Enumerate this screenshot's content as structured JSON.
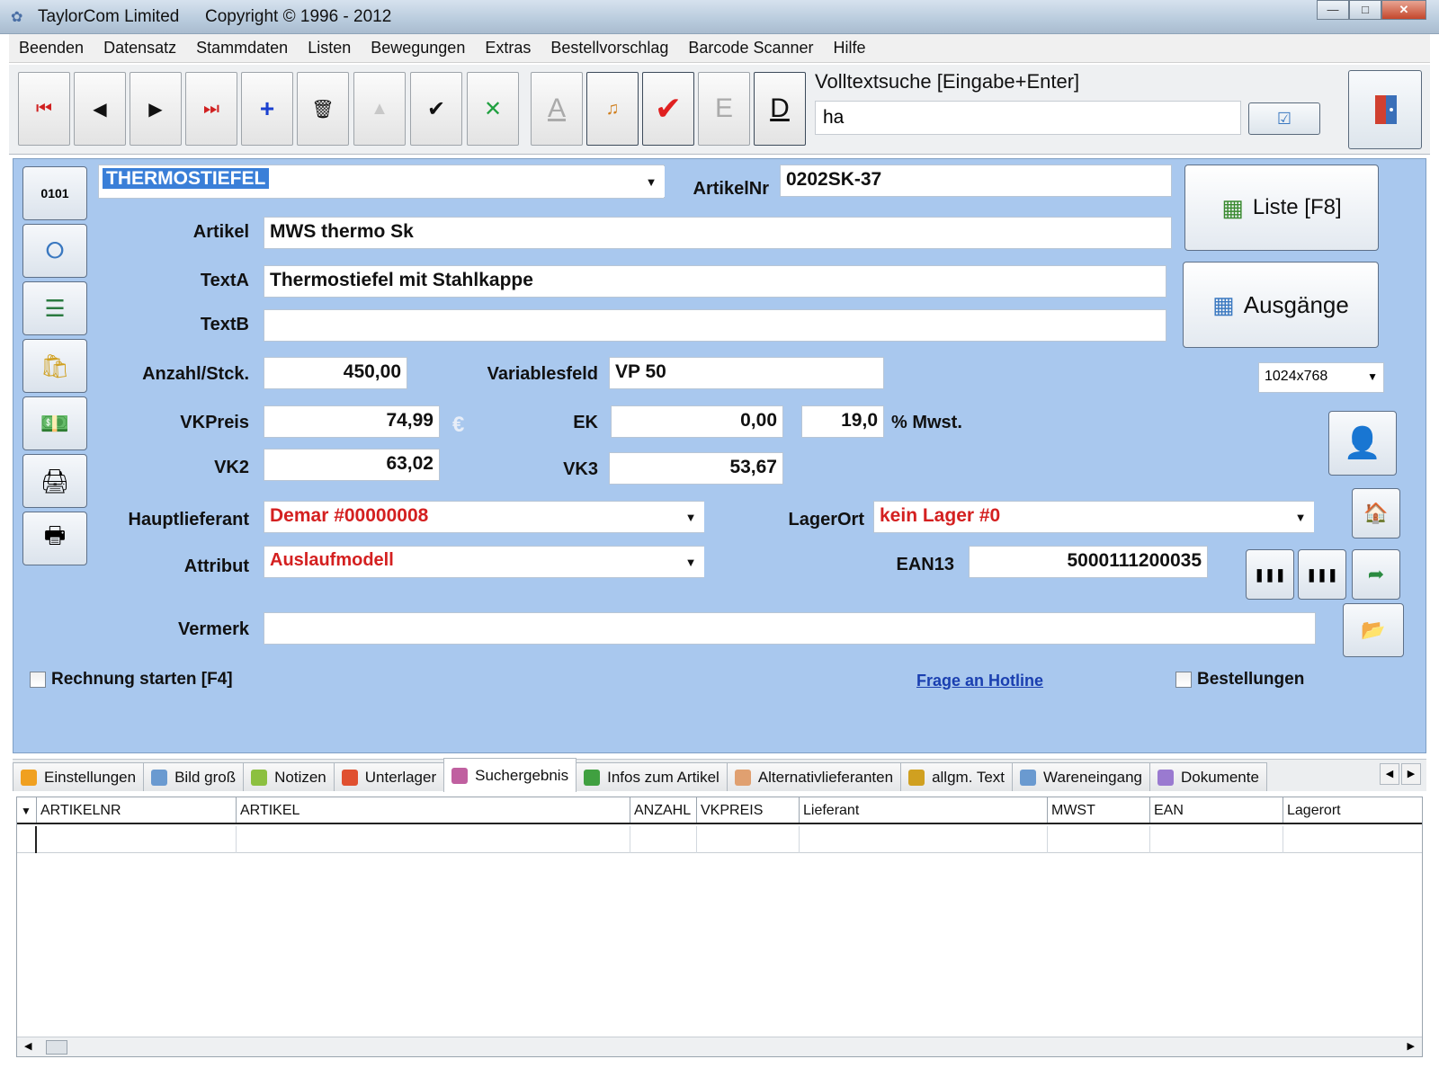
{
  "window": {
    "title": "TaylorCom Limited",
    "copyright": "Copyright © 1996 - 2012"
  },
  "menu": [
    "Beenden",
    "Datensatz",
    "Stammdaten",
    "Listen",
    "Bewegungen",
    "Extras",
    "Bestellvorschlag",
    "Barcode Scanner",
    "Hilfe"
  ],
  "toolbar": {
    "letter_a": "A",
    "letter_e": "E",
    "letter_d": "D",
    "search_label": "Volltextsuche [Eingabe+Enter]",
    "search_value": "ha"
  },
  "form": {
    "category": "THERMOSTIEFEL",
    "artikelnr_label": "ArtikelNr",
    "artikelnr": "0202SK-37",
    "artikel_label": "Artikel",
    "artikel": "MWS thermo Sk",
    "texta_label": "TextA",
    "texta": "Thermostiefel mit Stahlkappe",
    "textb_label": "TextB",
    "textb": "",
    "anzahl_label": "Anzahl/Stck.",
    "anzahl": "450,00",
    "variablesfeld_label": "Variablesfeld",
    "variablesfeld": "VP 50",
    "vkpreis_label": "VKPreis",
    "vkpreis": "74,99",
    "currency": "€",
    "ek_label": "EK",
    "ek": "0,00",
    "mwst": "19,0",
    "mwst_label": "% Mwst.",
    "vk2_label": "VK2",
    "vk2": "63,02",
    "vk3_label": "VK3",
    "vk3": "53,67",
    "hauptlieferant_label": "Hauptlieferant",
    "hauptlieferant": "Demar  #00000008",
    "lagerort_label": "LagerOrt",
    "lagerort": "kein Lager    #0",
    "attribut_label": "Attribut",
    "attribut": "Auslaufmodell",
    "ean13_label": "EAN13",
    "ean13": "5000111200035",
    "vermerk_label": "Vermerk",
    "vermerk": "",
    "liste_button": "Liste [F8]",
    "ausgaenge_button": "Ausgänge",
    "resolution": "1024x768",
    "rechnung_label": "Rechnung starten [F4]",
    "hotline_link": "Frage an Hotline",
    "bestellungen_label": "Bestellungen"
  },
  "tabs": [
    {
      "label": "Einstellungen",
      "icon": "settings-icon",
      "color": "#f0a020"
    },
    {
      "label": "Bild groß",
      "icon": "image-icon",
      "color": "#6a9ad0"
    },
    {
      "label": "Notizen",
      "icon": "notes-icon",
      "color": "#8cc040"
    },
    {
      "label": "Unterlager",
      "icon": "storage-icon",
      "color": "#e05030"
    },
    {
      "label": "Suchergebnis",
      "icon": "search-result-icon",
      "color": "#c060a0"
    },
    {
      "label": "Infos zum Artikel",
      "icon": "info-icon",
      "color": "#40a040"
    },
    {
      "label": "Alternativlieferanten",
      "icon": "supplier-icon",
      "color": "#e0a070"
    },
    {
      "label": "allgm. Text",
      "icon": "text-icon",
      "color": "#d0a020"
    },
    {
      "label": "Wareneingang",
      "icon": "goods-in-icon",
      "color": "#6a9ad0"
    },
    {
      "label": "Dokumente",
      "icon": "documents-icon",
      "color": "#9a7ad0"
    }
  ],
  "active_tab": "Suchergebnis",
  "grid": {
    "columns": [
      "ARTIKELNR",
      "ARTIKEL",
      "ANZAHL",
      "VKPREIS",
      "Lieferant",
      "MWST",
      "EAN",
      "Lagerort"
    ]
  },
  "colors": {
    "form_background": "#a9c8ee",
    "red_value": "#d42020",
    "link": "#1a3fb0",
    "selection": "#3a7fd8"
  }
}
